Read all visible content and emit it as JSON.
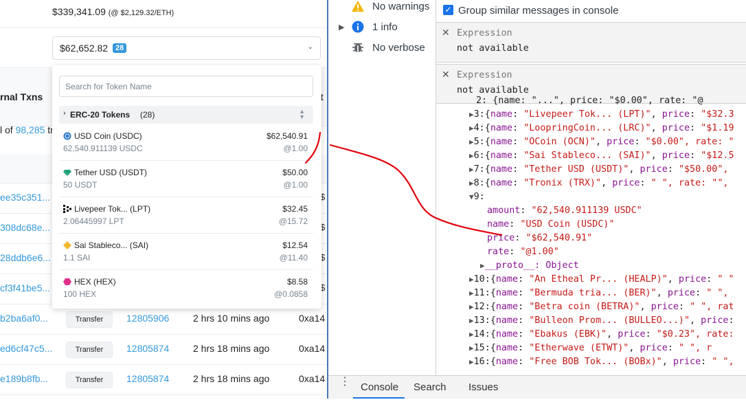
{
  "etherscan": {
    "eth_value": "$339,341.09",
    "eth_price": "(@ $2,129.32/ETH)",
    "token_value": "$62,652.82",
    "token_count": "28",
    "col_header": "rnal Txns",
    "of_prefix": "l of",
    "total_txns": "98,285",
    "total_suffix": "tr",
    "search_placeholder": "Search for Token Name",
    "group_label": "ERC-20 Tokens",
    "group_count": "(28)",
    "tokens": [
      {
        "name": "USD Coin (USDC)",
        "amount": "62,540.911139 USDC",
        "value": "$62,540.91",
        "rate": "@1.00",
        "icon": "usdc-icon",
        "color": "#2775ca"
      },
      {
        "name": "Tether USD (USDT)",
        "amount": "50 USDT",
        "value": "$50.00",
        "rate": "@1.00",
        "icon": "tether-icon",
        "color": "#26a17b"
      },
      {
        "name": "Livepeer Tok... (LPT)",
        "amount": "2.06445997 LPT",
        "value": "$32.45",
        "rate": "@15.72",
        "icon": "livepeer-icon",
        "color": "#000000"
      },
      {
        "name": "Sai Stableco... (SAI)",
        "amount": "1.1 SAI",
        "value": "$12.54",
        "rate": "@11.40",
        "icon": "sai-icon",
        "color": "#f4b731"
      },
      {
        "name": "HEX (HEX)",
        "amount": "100 HEX",
        "value": "$8.58",
        "rate": "@0.0858",
        "icon": "hex-icon",
        "color": "#e1308c"
      }
    ],
    "rows": [
      {
        "hash": "ee35c351...",
        "from": "",
        "off": "$"
      },
      {
        "hash": "308dc68e...",
        "from": "",
        "off": "$"
      },
      {
        "hash": "28ddb6e6...",
        "from": "",
        "off": "$"
      },
      {
        "hash": "cf3f41be5...",
        "from": "",
        "off": "$"
      },
      {
        "hash": "b2ba6af0...",
        "method": "Transfer",
        "block": "12805906",
        "age": "2 hrs 10 mins ago",
        "from": "0xa14"
      },
      {
        "hash": "ed6cf47c5...",
        "method": "Transfer",
        "block": "12805874",
        "age": "2 hrs 18 mins ago",
        "from": "0xa14"
      },
      {
        "hash": "e189b8fb...",
        "method": "Transfer",
        "block": "12805874",
        "age": "2 hrs 18 mins ago",
        "from": "0xa14"
      }
    ]
  },
  "devtools": {
    "sidebar": [
      {
        "label": "No warnings",
        "icon": "warning-icon"
      },
      {
        "label": "1 info",
        "icon": "info-icon"
      },
      {
        "label": "No verbose",
        "icon": "bug-icon"
      }
    ],
    "group_similar": "Group similar messages in console",
    "expressions": [
      {
        "title": "Expression",
        "value": "not available"
      },
      {
        "title": "Expression",
        "value": "not available"
      }
    ],
    "tabs": [
      "Console",
      "Search",
      "Issues"
    ],
    "console": {
      "partial_line": "2: {name: \"...\", price: \"$0.00\", rate: \"@",
      "items": [
        {
          "index": "3:",
          "name": "\"Livepeer Tok... (LPT)\"",
          "tail": "\"$32.3"
        },
        {
          "index": "4:",
          "name": "\"LoopringCoin... (LRC)\"",
          "tail": "\"$1.19"
        },
        {
          "index": "5:",
          "name": "\"OCoin (OCN)\"",
          "tail": "\"$0.00\", rate: \""
        },
        {
          "index": "6:",
          "name": "\"Sai Stableco... (SAI)\"",
          "tail": "\"$12.5"
        },
        {
          "index": "7:",
          "name": "\"Tether USD (USDT)\"",
          "tail": "\"$50.00\","
        },
        {
          "index": "8:",
          "name": "\"Tronix (TRX)\"",
          "tail": "\" \", rate: \"\", "
        }
      ],
      "expanded_index": "9:",
      "expanded": [
        {
          "key": "amount",
          "val": "\"62,540.911139 USDC\""
        },
        {
          "key": "name",
          "val": "\"USD Coin (USDC)\""
        },
        {
          "key": "price",
          "val": "\"$62,540.91\""
        },
        {
          "key": "rate",
          "val": "\"@1.00\""
        }
      ],
      "proto": "__proto__: Object",
      "items2": [
        {
          "index": "10:",
          "name": "\"An Etheal Pr... (HEALP)\"",
          "tail": "\" \""
        },
        {
          "index": "11:",
          "name": "\"Bermuda tria... (BER)\"",
          "tail": "\" \","
        },
        {
          "index": "12:",
          "name": "\"Betra coin (BETRA)\"",
          "tail": "\" \", rat"
        },
        {
          "index": "13:",
          "name": "\"Bulleon Prom... (BULLEO...)\"",
          "tail": ""
        },
        {
          "index": "14:",
          "name": "\"Ebakus (EBK)\"",
          "tail": "\"$0.23\", rate:"
        },
        {
          "index": "15:",
          "name": "\"Etherwave (ETWT)\"",
          "tail": "\" \", r"
        },
        {
          "index": "16:",
          "name": "\"Free BOB Tok... (BOBx)\"",
          "tail": "\" \","
        }
      ]
    }
  }
}
